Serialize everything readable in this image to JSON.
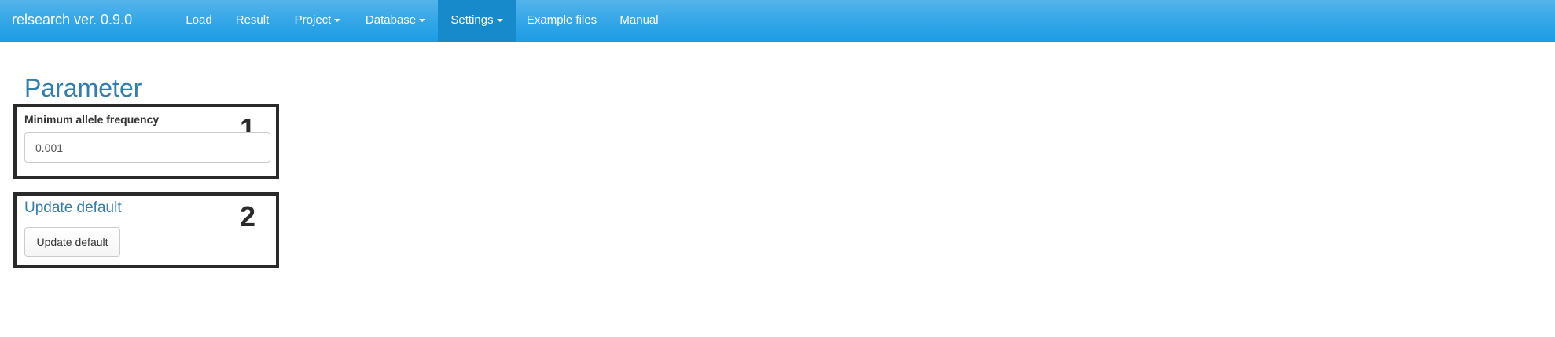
{
  "navbar": {
    "brand": "relsearch ver. 0.9.0",
    "items": [
      {
        "label": "Load",
        "dropdown": false,
        "active": false
      },
      {
        "label": "Result",
        "dropdown": false,
        "active": false
      },
      {
        "label": "Project",
        "dropdown": true,
        "active": false
      },
      {
        "label": "Database",
        "dropdown": true,
        "active": false
      },
      {
        "label": "Settings",
        "dropdown": true,
        "active": true
      },
      {
        "label": "Example files",
        "dropdown": false,
        "active": false
      },
      {
        "label": "Manual",
        "dropdown": false,
        "active": false
      }
    ]
  },
  "main": {
    "title": "Parameter",
    "box1": {
      "number": "1",
      "label": "Minimum allele frequency",
      "value": "0.001"
    },
    "box2": {
      "number": "2",
      "title": "Update default",
      "button_label": "Update default"
    }
  },
  "colors": {
    "navbar": "#2fa4e7",
    "navbar_active": "#178acc",
    "heading": "#317eac",
    "annotation_border": "#2a2a2a"
  }
}
